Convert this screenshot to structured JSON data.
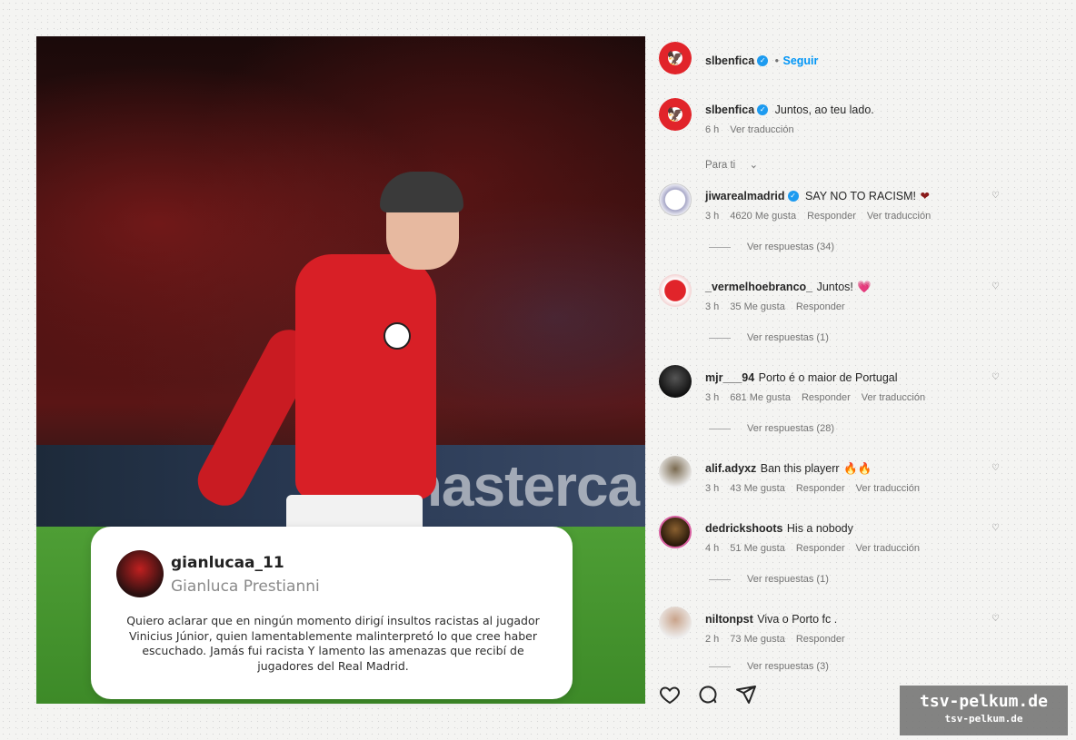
{
  "post": {
    "quote_card": {
      "username": "gianlucaa_11",
      "full_name": "Gianluca Prestianni",
      "text": "Quiero aclarar que en ningún momento dirigí insultos racistas al jugador Vinicius Júnior, quien lamentablemente malinterpretó lo que cree haber escuchado. Jamás fui racista Y lamento las amenazas que recibí de jugadores del Real Madrid."
    },
    "board_text": "masterca"
  },
  "header": {
    "username": "slbenfica",
    "separator": "•",
    "follow_label": "Seguir"
  },
  "caption": {
    "username": "slbenfica",
    "text": "Juntos, ao teu lado.",
    "time": "6 h",
    "translate": "Ver traducción"
  },
  "filter_label": "Para ti",
  "comments": [
    {
      "username": "jiwarealmadrid",
      "verified": true,
      "text": "SAY NO TO RACISM!",
      "emoji": "❤",
      "time": "3 h",
      "likes": "4620 Me gusta",
      "reply": "Responder",
      "translate": "Ver traducción",
      "view_replies": "Ver respuestas (34)"
    },
    {
      "username": "_vermelhoebranco_",
      "verified": false,
      "text": "Juntos!",
      "emoji": "💗",
      "time": "3 h",
      "likes": "35 Me gusta",
      "reply": "Responder",
      "translate": "",
      "view_replies": "Ver respuestas (1)"
    },
    {
      "username": "mjr___94",
      "verified": false,
      "text": "Porto é o maior de Portugal",
      "emoji": "",
      "time": "3 h",
      "likes": "681 Me gusta",
      "reply": "Responder",
      "translate": "Ver traducción",
      "view_replies": "Ver respuestas (28)"
    },
    {
      "username": "alif.adyxz",
      "verified": false,
      "text": "Ban this playerr",
      "emoji": "🔥🔥",
      "time": "3 h",
      "likes": "43 Me gusta",
      "reply": "Responder",
      "translate": "Ver traducción",
      "view_replies": ""
    },
    {
      "username": "dedrickshoots",
      "verified": false,
      "text": "His a nobody",
      "emoji": "",
      "time": "4 h",
      "likes": "51 Me gusta",
      "reply": "Responder",
      "translate": "Ver traducción",
      "view_replies": "Ver respuestas (1)"
    },
    {
      "username": "niltonpst",
      "verified": false,
      "text": "Viva o Porto fc .",
      "emoji": "",
      "time": "2 h",
      "likes": "73 Me gusta",
      "reply": "Responder",
      "translate": "",
      "view_replies": "Ver respuestas (3)"
    }
  ],
  "watermark": {
    "line1": "tsv-pelkum.de",
    "line2": "tsv-pelkum.de"
  },
  "icons": [
    "heart-icon",
    "comment-icon",
    "share-icon",
    "verified-icon"
  ],
  "colors": {
    "accent": "#0095f6",
    "verified": "#1d9bf0",
    "benfica_red": "#e1242a"
  }
}
